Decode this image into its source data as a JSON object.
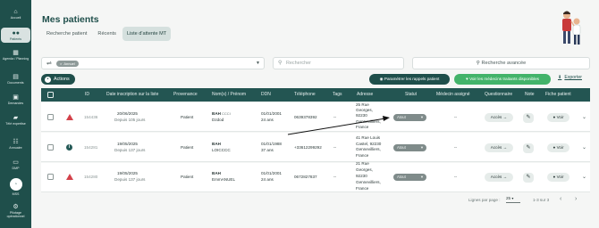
{
  "sidebar": {
    "items": [
      {
        "label": "Accueil",
        "icon": "home-icon",
        "glyph": "⌂"
      },
      {
        "label": "Patients",
        "icon": "users-icon",
        "glyph": "👥",
        "active": true
      },
      {
        "label": "Agenda / Planning",
        "icon": "calendar-icon",
        "glyph": "▦"
      },
      {
        "label": "Documents",
        "icon": "document-icon",
        "glyph": "▤"
      },
      {
        "label": "Demandes",
        "icon": "inbox-icon",
        "glyph": "▣"
      },
      {
        "label": "Télé expertise",
        "icon": "chat-icon",
        "glyph": "▰"
      },
      {
        "label": "Annuaire",
        "icon": "contacts-icon",
        "glyph": "☷"
      },
      {
        "label": "DMP",
        "icon": "folder-icon",
        "glyph": "▭"
      },
      {
        "label": "MSS",
        "icon": "avatar-icon",
        "glyph": "◔"
      },
      {
        "label": "Pilotage opérationnel",
        "icon": "gear-icon",
        "glyph": "⚙"
      }
    ]
  },
  "header": {
    "title": "Mes patients",
    "tabs": [
      {
        "label": "Recherche patient",
        "active": false
      },
      {
        "label": "Récents",
        "active": false
      },
      {
        "label": "Liste d'attente MT",
        "active": true
      }
    ]
  },
  "filters": {
    "chip": "Annuel",
    "search_placeholder": "Rechercher",
    "advanced_label": "Recherche avancée"
  },
  "toolbar": {
    "actions_label": "Actions",
    "reminders_label": "Paramétrer les rappels patient",
    "doctors_label": "Voir les médecins traitants disponibles",
    "export_label": "Exporter"
  },
  "table": {
    "columns": [
      "ID",
      "Date inscription sur la liste",
      "Provenance",
      "Nom(s) / Prénom",
      "DDN",
      "Téléphone",
      "Tags",
      "Adresse",
      "Statut",
      "Médecin assigné",
      "Questionnaire",
      "Note",
      "Fiche patient"
    ],
    "rows": [
      {
        "alert": "warning",
        "id": "154436",
        "date": "20/06/2025",
        "since": "Depuis 105 jours",
        "provenance": "Patient",
        "lastname": "BAH",
        "lastname_extra": "CCCI",
        "firstname": "Dzdod",
        "ddn": "01/01/2001",
        "age": "24 ans",
        "phone": "0639378392",
        "tags": "--",
        "address": [
          "25 Rue",
          "Georges,",
          "92230",
          "Gennevilliers,",
          "France"
        ],
        "status": "Atout",
        "doctor": "--",
        "questionnaire": "Accès →",
        "view": "Voir"
      },
      {
        "alert": "info",
        "id": "154281",
        "date": "19/05/2025",
        "since": "Depuis 137 jours",
        "provenance": "Patient",
        "lastname": "BAH",
        "lastname_extra": "",
        "firstname": "LOICCCC",
        "ddn": "01/01/1988",
        "age": "37 ans",
        "phone": "+33612299292",
        "tags": "--",
        "address": [
          "41 Rue Louis",
          "Castel, 92230",
          "Gennevilliers,",
          "France"
        ],
        "status": "Atout",
        "doctor": "--",
        "questionnaire": "Accès →",
        "view": "Voir"
      },
      {
        "alert": "warning",
        "id": "154280",
        "date": "19/05/2025",
        "since": "Depuis 137 jours",
        "provenance": "Patient",
        "lastname": "BAH",
        "lastname_extra": "",
        "firstname": "EmmANUEL",
        "ddn": "01/01/2001",
        "age": "24 ans",
        "phone": "0672827837",
        "tags": "--",
        "address": [
          "21 Rue",
          "Georges,",
          "92230",
          "Gennevilliers,",
          "France"
        ],
        "status": "Atout",
        "doctor": "--",
        "questionnaire": "Accès →",
        "view": "Voir"
      }
    ]
  },
  "pagination": {
    "rows_label": "Lignes par page :",
    "rows_value": "25",
    "range": "1-3 sur 3",
    "prev": "‹",
    "next": "›"
  },
  "colors": {
    "sidebar": "#1f4f4b",
    "accent": "#1f4f4b",
    "green": "#43b36a",
    "alert_red": "#d3414a"
  }
}
